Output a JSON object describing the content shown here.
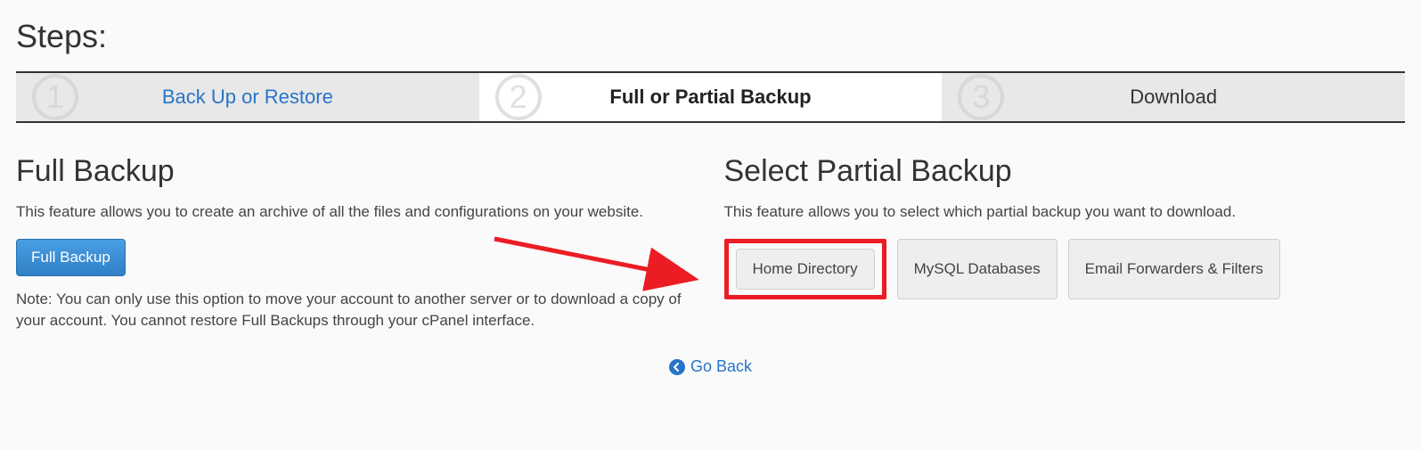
{
  "page_title": "Steps:",
  "steps": [
    {
      "num": "1",
      "label": "Back Up or Restore"
    },
    {
      "num": "2",
      "label": "Full or Partial Backup"
    },
    {
      "num": "3",
      "label": "Download"
    }
  ],
  "full_backup": {
    "title": "Full Backup",
    "desc": "This feature allows you to create an archive of all the files and configurations on your website.",
    "button": "Full Backup",
    "note": "Note: You can only use this option to move your account to another server or to download a copy of your account. You cannot restore Full Backups through your cPanel interface."
  },
  "partial_backup": {
    "title": "Select Partial Backup",
    "desc": "This feature allows you to select which partial backup you want to download.",
    "buttons": {
      "home": "Home Directory",
      "mysql": "MySQL Databases",
      "email": "Email Forwarders & Filters"
    }
  },
  "go_back": "Go Back"
}
